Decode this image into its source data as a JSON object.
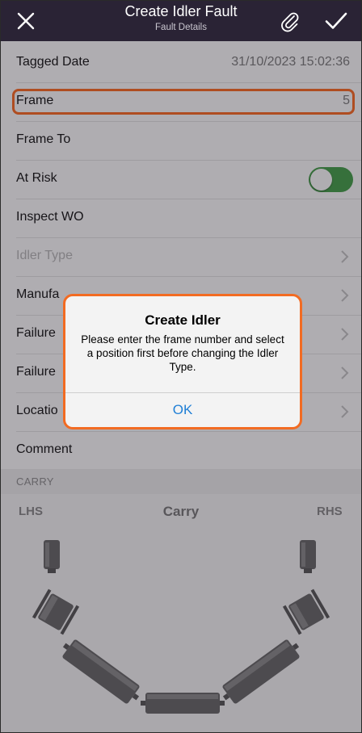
{
  "header": {
    "title": "Create Idler Fault",
    "subtitle": "Fault Details",
    "close_icon": "close-icon",
    "attach_icon": "paperclip-icon",
    "save_icon": "checkmark-icon"
  },
  "form": {
    "tagged_date": {
      "label": "Tagged Date",
      "value": "31/10/2023 15:02:36"
    },
    "frame": {
      "label": "Frame",
      "value": "5"
    },
    "frame_to": {
      "label": "Frame To"
    },
    "at_risk": {
      "label": "At Risk",
      "toggled": true
    },
    "inspect_wo": {
      "label": "Inspect WO"
    },
    "idler_type": {
      "label": "Idler Type"
    },
    "manufacturer": {
      "label": "Manufa"
    },
    "failure1": {
      "label": "Failure"
    },
    "failure2": {
      "label": "Failure"
    },
    "location": {
      "label": "Locatio"
    },
    "comment": {
      "label": "Comment"
    }
  },
  "section": {
    "label": "CARRY"
  },
  "carry": {
    "left_label": "LHS",
    "title": "Carry",
    "right_label": "RHS"
  },
  "dialog": {
    "title": "Create Idler",
    "message": "Please enter the frame number and select a position first before changing the Idler Type.",
    "ok_label": "OK"
  },
  "colors": {
    "header_bg": "#2a2335",
    "toggle_on": "#43a047",
    "highlight": "#ff6a1f",
    "link_blue": "#1f7fd6"
  }
}
